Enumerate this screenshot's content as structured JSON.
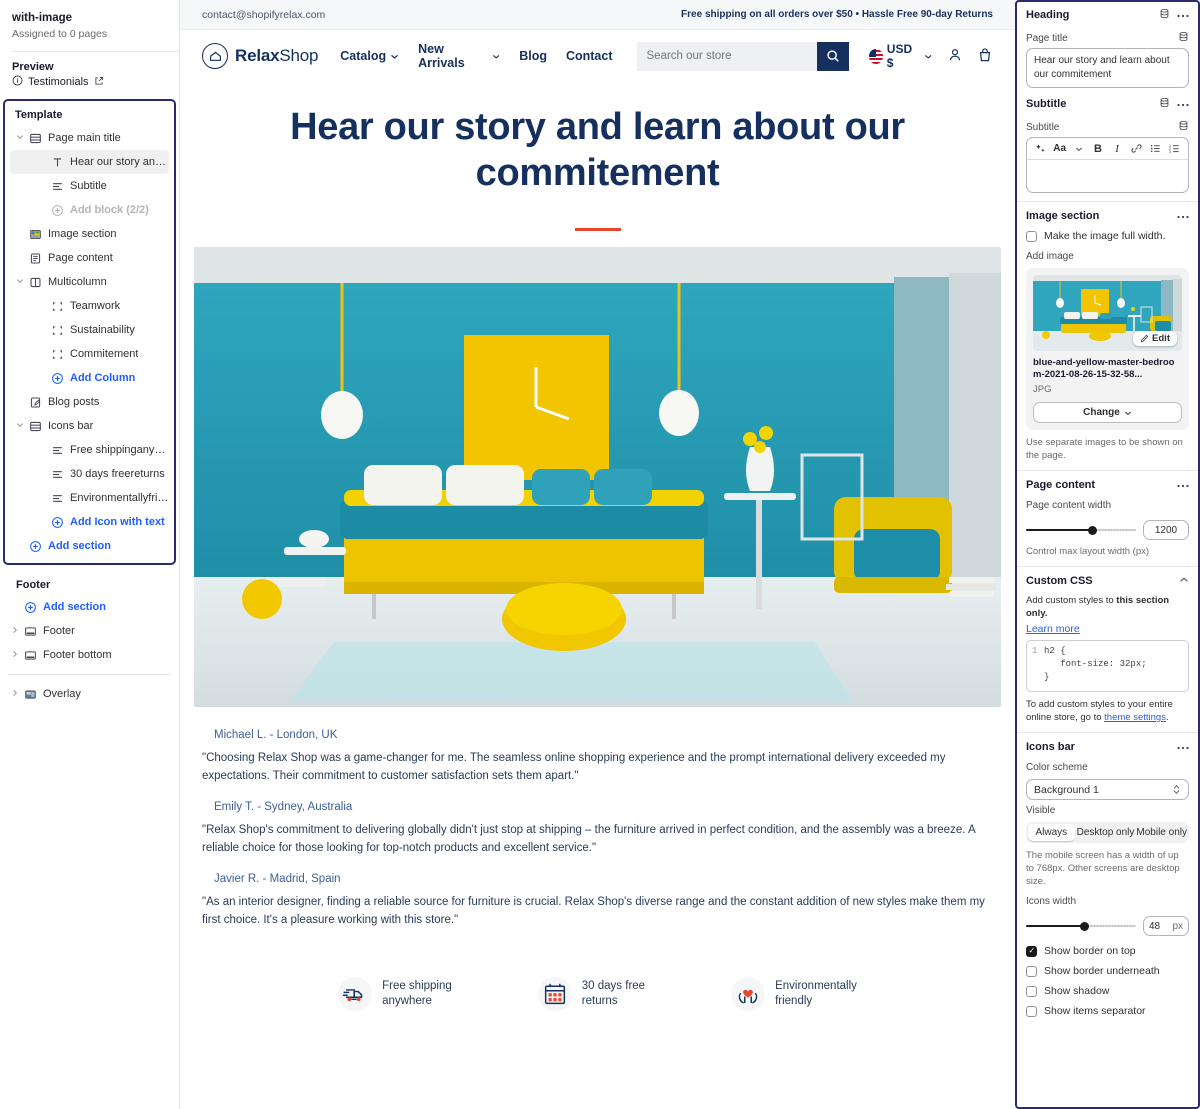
{
  "sidebar": {
    "template_name": "with-image",
    "assigned": "Assigned to 0 pages",
    "preview_label": "Preview",
    "preview_item": "Testimonials",
    "template_label": "Template",
    "items": [
      {
        "label": "Page main title",
        "icon": "section-icon",
        "level": 1,
        "caret": "expanded",
        "type": "section"
      },
      {
        "label": "Hear our story and learn ab...",
        "icon": "text-block-icon",
        "level": 2,
        "type": "block",
        "selected": true
      },
      {
        "label": "Subtitle",
        "icon": "paragraph-icon",
        "level": 2,
        "type": "block"
      },
      {
        "label": "Add block (2/2)",
        "icon": "plus-circle-icon",
        "level": 2,
        "type": "add",
        "disabled": true
      },
      {
        "label": "Image section",
        "icon": "image-icon",
        "level": 1,
        "type": "section"
      },
      {
        "label": "Page content",
        "icon": "page-icon",
        "level": 1,
        "type": "section"
      },
      {
        "label": "Multicolumn",
        "icon": "columns-icon",
        "level": 1,
        "caret": "expanded",
        "type": "section"
      },
      {
        "label": "Teamwork",
        "icon": "column-block-icon",
        "level": 2,
        "type": "block"
      },
      {
        "label": "Sustainability",
        "icon": "column-block-icon",
        "level": 2,
        "type": "block"
      },
      {
        "label": "Commitement",
        "icon": "column-block-icon",
        "level": 2,
        "type": "block"
      },
      {
        "label": "Add Column",
        "icon": "plus-circle-icon",
        "level": 2,
        "type": "add"
      },
      {
        "label": "Blog posts",
        "icon": "blog-icon",
        "level": 1,
        "type": "section"
      },
      {
        "label": "Icons bar",
        "icon": "section-icon",
        "level": 1,
        "caret": "expanded",
        "type": "section"
      },
      {
        "label": "Free shippinganywhere",
        "icon": "paragraph-icon",
        "level": 2,
        "type": "block"
      },
      {
        "label": "30 days freereturns",
        "icon": "paragraph-icon",
        "level": 2,
        "type": "block"
      },
      {
        "label": "Environmentallyfriendly",
        "icon": "paragraph-icon",
        "level": 2,
        "type": "block"
      },
      {
        "label": "Add Icon with text",
        "icon": "plus-circle-icon",
        "level": 2,
        "type": "add"
      },
      {
        "label": "Add section",
        "icon": "plus-circle-icon",
        "level": 1,
        "type": "add"
      }
    ],
    "footer_group_label": "Footer",
    "footer_items": [
      {
        "label": "Add section",
        "icon": "plus-circle-icon",
        "type": "add"
      },
      {
        "label": "Footer",
        "icon": "footer-icon",
        "type": "section",
        "caret": "collapsed"
      },
      {
        "label": "Footer bottom",
        "icon": "footer-icon",
        "type": "section",
        "caret": "collapsed"
      }
    ],
    "overlay_items": [
      {
        "label": "Overlay",
        "icon": "overlay-icon",
        "type": "section",
        "caret": "collapsed"
      }
    ]
  },
  "preview": {
    "announcement_left": "contact@shopifyrelax.com",
    "announcement_right": "Free shipping on all orders over $50 • Hassle Free 90-day Returns",
    "brand_bold": "Relax",
    "brand_light": "Shop",
    "nav": [
      {
        "label": "Catalog",
        "has_caret": true
      },
      {
        "label": "New Arrivals",
        "has_caret": true
      },
      {
        "label": "Blog",
        "has_caret": false
      },
      {
        "label": "Contact",
        "has_caret": false
      }
    ],
    "search_placeholder": "Search our store",
    "currency": "USD $",
    "heading": "Hear our story and learn about our commitement",
    "testimonials": [
      {
        "name": "Michael L. - London, UK",
        "quote": "\"Choosing Relax Shop was a game-changer for me. The seamless online shopping experience and the prompt international delivery exceeded my expectations. Their commitment to customer satisfaction sets them apart.\""
      },
      {
        "name": "Emily T. - Sydney, Australia",
        "quote": "\"Relax Shop's commitment to delivering globally didn't just stop at shipping – the furniture arrived in perfect condition, and the assembly was a breeze. A reliable choice for those looking for top-notch products and excellent service.\""
      },
      {
        "name": "Javier R. - Madrid, Spain",
        "quote": "\"As an interior designer, finding a reliable source for furniture is crucial. Relax Shop's diverse range and the constant addition of new styles make them my first choice. It's a pleasure working with this store.\""
      }
    ],
    "icons_bar": [
      {
        "icon": "truck-icon",
        "line1": "Free shipping",
        "line2": "anywhere"
      },
      {
        "icon": "calendar-icon",
        "line1": "30 days free",
        "line2": "returns"
      },
      {
        "icon": "hands-heart-icon",
        "line1": "Environmentally",
        "line2": "friendly"
      }
    ]
  },
  "inspector": {
    "heading_section": {
      "title": "Heading",
      "page_title_label": "Page title",
      "page_title_value": "Hear our story and learn about our commitement"
    },
    "subtitle_section": {
      "title": "Subtitle",
      "field_label": "Subtitle",
      "value": "",
      "toolbar": [
        "ai-icon",
        "font-size-icon",
        "chevron-down-icon",
        "bold-icon",
        "italic-icon",
        "link-icon",
        "bullet-list-icon",
        "numbered-list-icon"
      ]
    },
    "image_section": {
      "title": "Image section",
      "full_width_label": "Make the image full width.",
      "full_width_checked": false,
      "add_image_label": "Add image",
      "edit_label": "Edit",
      "file_name": "blue-and-yellow-master-bedroom-2021-08-26-15-32-58...",
      "file_type": "JPG",
      "change_label": "Change",
      "helper": "Use separate images to be shown on the page."
    },
    "page_content_section": {
      "title": "Page content",
      "width_label": "Page content width",
      "width_value": "1200",
      "helper": "Control max layout width (px)"
    },
    "custom_css_section": {
      "title": "Custom CSS",
      "desc_prefix": "Add custom styles to ",
      "desc_bold": "this section only.",
      "learn_more": "Learn more",
      "code_line_no": "1",
      "code_line1": "h2 {",
      "code_line2": "font-size: 32px;",
      "code_line3": "}",
      "note_prefix": "To add custom styles to your entire online store, go to ",
      "note_link": "theme settings",
      "note_suffix": "."
    },
    "icons_bar_section": {
      "title": "Icons bar",
      "color_scheme_label": "Color scheme",
      "color_scheme_value": "Background 1",
      "visible_label": "Visible",
      "visible_options": [
        "Always",
        "Desktop only",
        "Mobile only"
      ],
      "visible_selected": "Always",
      "visible_helper": "The mobile screen has a width of up to 768px. Other screens are desktop size.",
      "icons_width_label": "Icons width",
      "icons_width_value": "48",
      "icons_width_unit": "px",
      "checkboxes": [
        {
          "label": "Show border on top",
          "checked": true
        },
        {
          "label": "Show border underneath",
          "checked": false
        },
        {
          "label": "Show shadow",
          "checked": false
        },
        {
          "label": "Show items separator",
          "checked": false
        }
      ]
    }
  },
  "colors": {
    "brand_navy": "#15305e",
    "accent_red": "#e8452c",
    "link_blue": "#1f5eff",
    "selection_outline": "#2a2a6e"
  }
}
